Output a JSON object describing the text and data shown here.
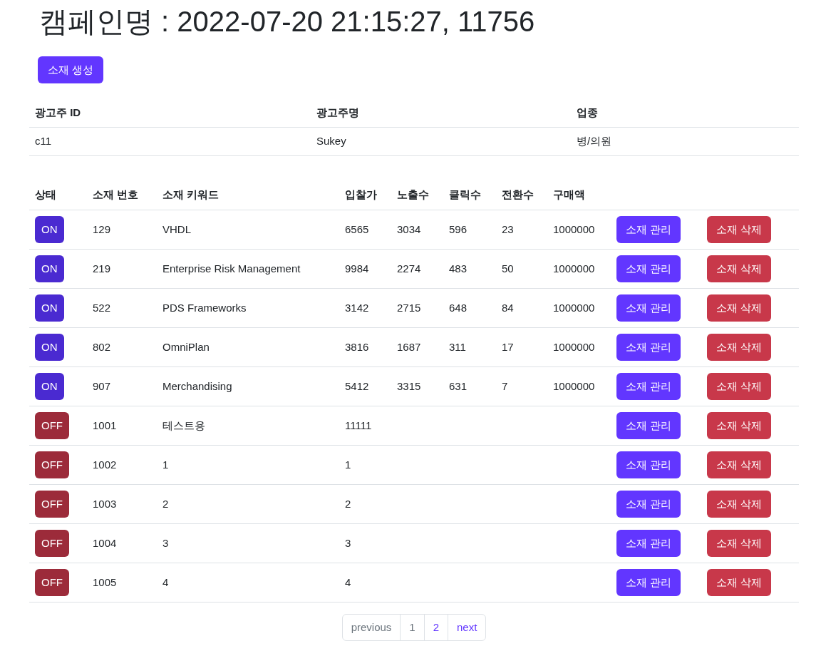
{
  "title": "캠페인명 : 2022-07-20 21:15:27, 11756",
  "create_button": "소재 생성",
  "advertiser": {
    "columns": [
      "광고주 ID",
      "광고주명",
      "업종"
    ],
    "row": [
      "c11",
      "Sukey",
      "병/의원"
    ]
  },
  "table": {
    "columns": [
      "상태",
      "소재 번호",
      "소재 키워드",
      "입찰가",
      "노출수",
      "클릭수",
      "전환수",
      "구매액"
    ],
    "rows": [
      {
        "status": "ON",
        "on": true,
        "number": "129",
        "keyword": "VHDL",
        "bid": "6565",
        "impressions": "3034",
        "clicks": "596",
        "conversions": "23",
        "purchase": "1000000",
        "manage": "소재 관리",
        "delete": "소재 삭제"
      },
      {
        "status": "ON",
        "on": true,
        "number": "219",
        "keyword": "Enterprise Risk Management",
        "bid": "9984",
        "impressions": "2274",
        "clicks": "483",
        "conversions": "50",
        "purchase": "1000000",
        "manage": "소재 관리",
        "delete": "소재 삭제"
      },
      {
        "status": "ON",
        "on": true,
        "number": "522",
        "keyword": "PDS Frameworks",
        "bid": "3142",
        "impressions": "2715",
        "clicks": "648",
        "conversions": "84",
        "purchase": "1000000",
        "manage": "소재 관리",
        "delete": "소재 삭제"
      },
      {
        "status": "ON",
        "on": true,
        "number": "802",
        "keyword": "OmniPlan",
        "bid": "3816",
        "impressions": "1687",
        "clicks": "311",
        "conversions": "17",
        "purchase": "1000000",
        "manage": "소재 관리",
        "delete": "소재 삭제"
      },
      {
        "status": "ON",
        "on": true,
        "number": "907",
        "keyword": "Merchandising",
        "bid": "5412",
        "impressions": "3315",
        "clicks": "631",
        "conversions": "7",
        "purchase": "1000000",
        "manage": "소재 관리",
        "delete": "소재 삭제"
      },
      {
        "status": "OFF",
        "on": false,
        "number": "1001",
        "keyword": "테스트용",
        "bid": "11111",
        "manage": "소재 관리",
        "delete": "소재 삭제"
      },
      {
        "status": "OFF",
        "on": false,
        "number": "1002",
        "keyword": "1",
        "bid": "1",
        "manage": "소재 관리",
        "delete": "소재 삭제"
      },
      {
        "status": "OFF",
        "on": false,
        "number": "1003",
        "keyword": "2",
        "bid": "2",
        "manage": "소재 관리",
        "delete": "소재 삭제"
      },
      {
        "status": "OFF",
        "on": false,
        "number": "1004",
        "keyword": "3",
        "bid": "3",
        "manage": "소재 관리",
        "delete": "소재 삭제"
      },
      {
        "status": "OFF",
        "on": false,
        "number": "1005",
        "keyword": "4",
        "bid": "4",
        "manage": "소재 관리",
        "delete": "소재 삭제"
      }
    ]
  },
  "pagination": {
    "previous": {
      "label": "previous",
      "disabled": true
    },
    "pages": [
      {
        "label": "1",
        "selected": true
      },
      {
        "label": "2",
        "selected": false
      }
    ],
    "next": {
      "label": "next",
      "disabled": false
    }
  }
}
